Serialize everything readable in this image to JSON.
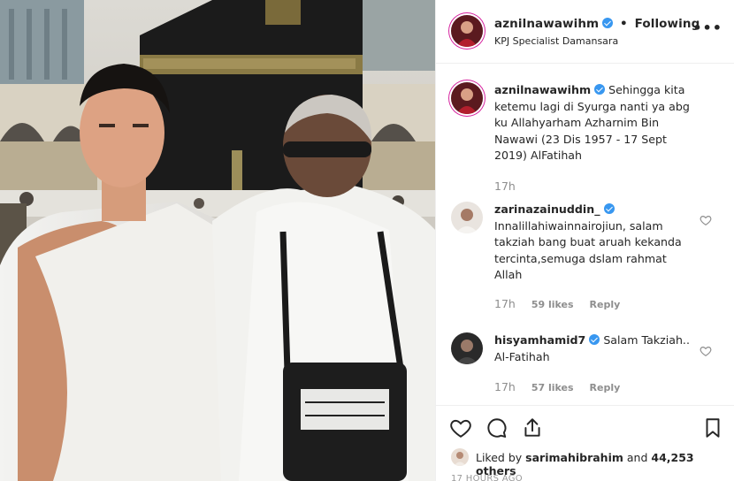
{
  "post": {
    "username": "aznilnawawihm",
    "follow_separator": "•",
    "follow_label": "Following",
    "location": "KPJ Specialist Damansara",
    "more_label": "•••"
  },
  "caption": {
    "username": "aznilnawawihm",
    "text": "Sehingga kita ketemu lagi di Syurga nanti ya abg ku Allahyarham Azharnim Bin Nawawi (23 Dis 1957 - 17 Sept 2019) AlFatihah",
    "time": "17h"
  },
  "comments": [
    {
      "username": "zarinazainuddin_",
      "verified": true,
      "text": "Innalillahiwainnairojiun, salam takziah bang buat aruah kekanda tercinta,semuga dslam rahmat Allah",
      "time": "17h",
      "likes": "59 likes",
      "reply": "Reply"
    },
    {
      "username": "hisyamhamid7",
      "verified": true,
      "text": "Salam Takziah.. Al-Fatihah",
      "time": "17h",
      "likes": "57 likes",
      "reply": "Reply"
    }
  ],
  "likes_bar": {
    "prefix": "Liked by",
    "liker": "sarimahibrahim",
    "joiner": "and",
    "count": "44,253 others"
  },
  "posted_ago": "17 HOURS AGO",
  "icons": {
    "like": "heart-icon",
    "comment": "comment-bubble-icon",
    "share": "share-icon",
    "save": "bookmark-icon",
    "verified": "verified-badge-icon"
  },
  "colors": {
    "verified": "#3897f0",
    "muted": "#8e8e8e",
    "text": "#262626",
    "border": "#efefef"
  }
}
